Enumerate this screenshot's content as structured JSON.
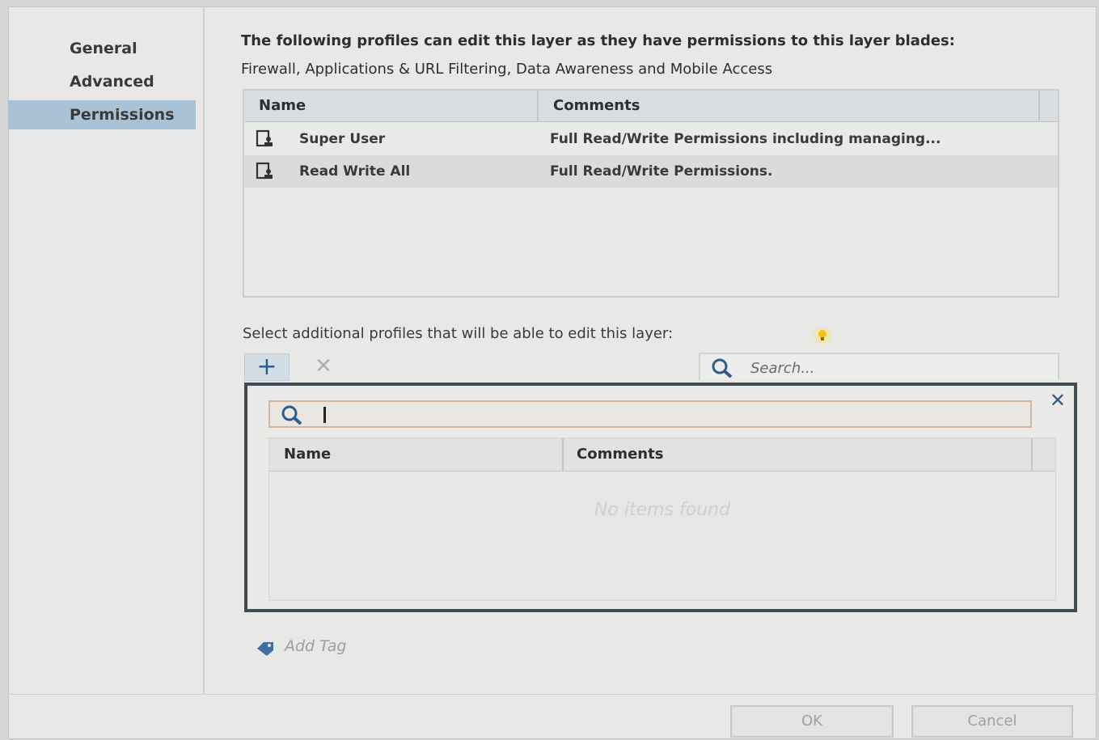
{
  "sidebar": {
    "items": [
      {
        "label": "General"
      },
      {
        "label": "Advanced"
      },
      {
        "label": "Permissions",
        "active": true
      }
    ]
  },
  "permissions": {
    "description_line1": "The following profiles can edit this layer as they have permissions to this layer blades:",
    "description_line2": "Firewall, Applications & URL Filtering, Data Awareness and Mobile Access",
    "table": {
      "columns": [
        "Name",
        "Comments"
      ],
      "rows": [
        {
          "name": "Super User",
          "comment": "Full Read/Write Permissions including managing..."
        },
        {
          "name": "Read Write All",
          "comment": "Full Read/Write Permissions."
        }
      ]
    },
    "additional_label": "Select additional profiles that will be able to edit this layer:",
    "search_placeholder": "Search...",
    "popup": {
      "search_value": "",
      "columns": [
        "Name",
        "Comments"
      ],
      "empty_message": "No items found"
    },
    "add_tag_label": "Add Tag"
  },
  "buttons": {
    "ok": "OK",
    "cancel": "Cancel"
  },
  "colors": {
    "active_nav": "#a9c2d6",
    "popup_border": "#3f4a55",
    "accent_blue": "#2e5c8a",
    "hint_yellow": "#f0c419"
  }
}
